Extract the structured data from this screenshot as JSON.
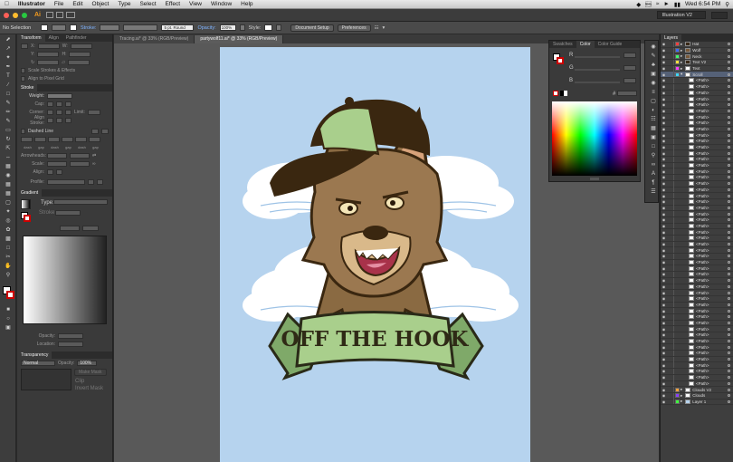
{
  "menubar": {
    "apple": "",
    "app": "Illustrator",
    "items": [
      "File",
      "Edit",
      "Object",
      "Type",
      "Select",
      "Effect",
      "View",
      "Window",
      "Help"
    ],
    "clock": "Wed 6:54 PM"
  },
  "titlebar": {
    "logo": "Ai",
    "workspace": "Illustration V2"
  },
  "control": {
    "selection": "No Selection",
    "stroke_label": "Stroke:",
    "brush": "5 pt. Round",
    "opacity_label": "Opacity:",
    "opacity": "100%",
    "style_label": "Style:",
    "doc_setup": "Document Setup",
    "preferences": "Preferences"
  },
  "tabs": [
    {
      "label": "Tracing.ai* @ 33% (RGB/Preview)"
    },
    {
      "label": "partywolf11.ai* @ 33% (RGB/Preview)"
    }
  ],
  "transform_panel": {
    "tabs": [
      "Transform",
      "Align",
      "Pathfinder"
    ],
    "scale_strokes": "Scale Strokes & Effects",
    "align_grid": "Align to Pixel Grid"
  },
  "stroke_panel": {
    "title": "Stroke",
    "weight": "Weight:",
    "cap": "Cap:",
    "corner": "Corner:",
    "limit": "Limit:",
    "align": "Align Stroke:",
    "dashed": "Dashed Line",
    "dash_labels": [
      "dash",
      "gap",
      "dash",
      "gap",
      "dash",
      "gap"
    ],
    "arrowheads": "Arrowheads:",
    "scale": "Scale:",
    "align_arrow": "Align:",
    "profile": "Profile:"
  },
  "gradient_panel": {
    "title": "Gradient",
    "type": "Type:",
    "stroke": "Stroke:",
    "opacity": "Opacity:",
    "location": "Location:"
  },
  "transparency_panel": {
    "title": "Transparency",
    "mode": "Normal",
    "opacity_label": "Opacity:",
    "opacity": "100%",
    "make_mask": "Make Mask",
    "clip": "Clip",
    "invert": "Invert Mask"
  },
  "color_panel": {
    "tabs": [
      "Swatches",
      "Color",
      "Color Guide"
    ],
    "channels": [
      "R",
      "G",
      "B"
    ],
    "hex_prefix": "#"
  },
  "artwork": {
    "banner_text": "OFF THE HOOK"
  },
  "layers": {
    "title": "Layers",
    "rows": [
      {
        "name": "Hat",
        "color": "#ff3d3d",
        "thumb": "#3a2a18"
      },
      {
        "name": "Wolf",
        "color": "#3d6bff",
        "thumb": "#7a5a3a"
      },
      {
        "name": "Neck",
        "color": "#3dff6b",
        "thumb": "#7a5a3a"
      },
      {
        "name": "Text V2",
        "color": "#ffe13d",
        "thumb": "#3a2a18"
      },
      {
        "name": "Text",
        "color": "#ff3dff",
        "thumb": "#ffffff"
      },
      {
        "name": "Scroll",
        "color": "#3dd6ff",
        "thumb": "#ffffff",
        "highlight": true
      },
      {
        "name": "<Path>"
      },
      {
        "name": "<Path>"
      },
      {
        "name": "<Path>"
      },
      {
        "name": "<Path>"
      },
      {
        "name": "<Path>"
      },
      {
        "name": "<Path>"
      },
      {
        "name": "<Path>"
      },
      {
        "name": "<Path>"
      },
      {
        "name": "<Path>"
      },
      {
        "name": "<Path>"
      },
      {
        "name": "<Path>"
      },
      {
        "name": "<Path>"
      },
      {
        "name": "<Path>"
      },
      {
        "name": "<Path>"
      },
      {
        "name": "<Path>"
      },
      {
        "name": "<Path>"
      },
      {
        "name": "<Path>"
      },
      {
        "name": "<Path>"
      },
      {
        "name": "<Path>"
      },
      {
        "name": "<Path>"
      },
      {
        "name": "<Path>"
      },
      {
        "name": "<Path>"
      },
      {
        "name": "<Path>"
      },
      {
        "name": "<Path>"
      },
      {
        "name": "<Path>"
      },
      {
        "name": "<Path>"
      },
      {
        "name": "<Path>"
      },
      {
        "name": "<Path>"
      },
      {
        "name": "<Path>"
      },
      {
        "name": "<Path>"
      },
      {
        "name": "<Path>"
      },
      {
        "name": "<Path>"
      },
      {
        "name": "<Path>"
      },
      {
        "name": "<Path>"
      },
      {
        "name": "<Path>"
      },
      {
        "name": "<Path>"
      },
      {
        "name": "<Path>"
      },
      {
        "name": "<Path>"
      },
      {
        "name": "<Path>"
      },
      {
        "name": "<Path>"
      },
      {
        "name": "<Path>"
      },
      {
        "name": "<Path>"
      },
      {
        "name": "<Path>"
      },
      {
        "name": "<Path>"
      },
      {
        "name": "<Path>"
      },
      {
        "name": "<Path>"
      },
      {
        "name": "<Path>"
      },
      {
        "name": "<Path>"
      },
      {
        "name": "<Path>"
      },
      {
        "name": "<Path>"
      },
      {
        "name": "<Path>"
      },
      {
        "name": "Clouds V2",
        "color": "#ffa33d",
        "thumb": "#ffffff"
      },
      {
        "name": "Clouds",
        "color": "#8a3dff",
        "thumb": "#ffffff"
      },
      {
        "name": "Layer 1",
        "color": "#3dff3d",
        "thumb": "#b6d3ee"
      }
    ]
  }
}
